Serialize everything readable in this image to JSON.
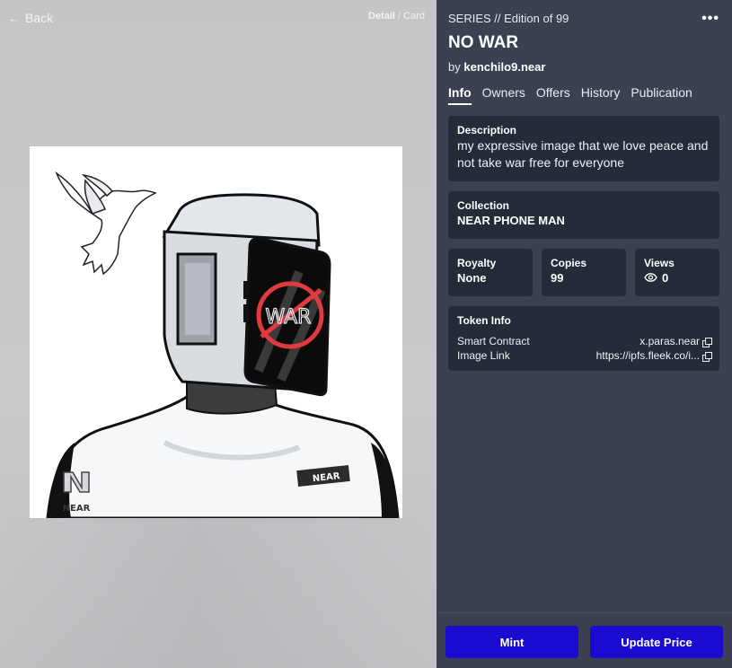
{
  "nav": {
    "back_label": "Back",
    "back_icon": "arrow-left-icon"
  },
  "view_toggle": {
    "detail": "Detail",
    "separator": "/",
    "card": "Card"
  },
  "artwork": {
    "text_war": "WAR",
    "badge_text": "NEAR",
    "shoulder_logo_text": "NEAR"
  },
  "token": {
    "series_label": "SERIES // Edition of 99",
    "title": "NO WAR",
    "by_prefix": "by",
    "creator": "kenchilo9.near",
    "more_icon": "more-horizontal-icon"
  },
  "tabs": [
    {
      "label": "Info",
      "active": true
    },
    {
      "label": "Owners"
    },
    {
      "label": "Offers"
    },
    {
      "label": "History"
    },
    {
      "label": "Publication"
    }
  ],
  "info": {
    "description": {
      "label": "Description",
      "text": "my expressive image that we love peace and not take war free for everyone"
    },
    "collection": {
      "label": "Collection",
      "value": "NEAR PHONE MAN"
    },
    "royalty": {
      "label": "Royalty",
      "value": "None"
    },
    "copies": {
      "label": "Copies",
      "value": "99"
    },
    "views": {
      "label": "Views",
      "value": "0",
      "icon": "eye-icon"
    },
    "token_info": {
      "label": "Token Info",
      "smart_contract_label": "Smart Contract",
      "smart_contract_value": "x.paras.near",
      "image_link_label": "Image Link",
      "image_link_value": "https://ipfs.fleek.co/i..."
    }
  },
  "actions": {
    "mint": "Mint",
    "update_price": "Update Price"
  },
  "colors": {
    "panel_bg": "#3b4150",
    "card_bg": "#252b38",
    "primary_button": "#1b0ad0",
    "war_red": "#e03a3e"
  }
}
